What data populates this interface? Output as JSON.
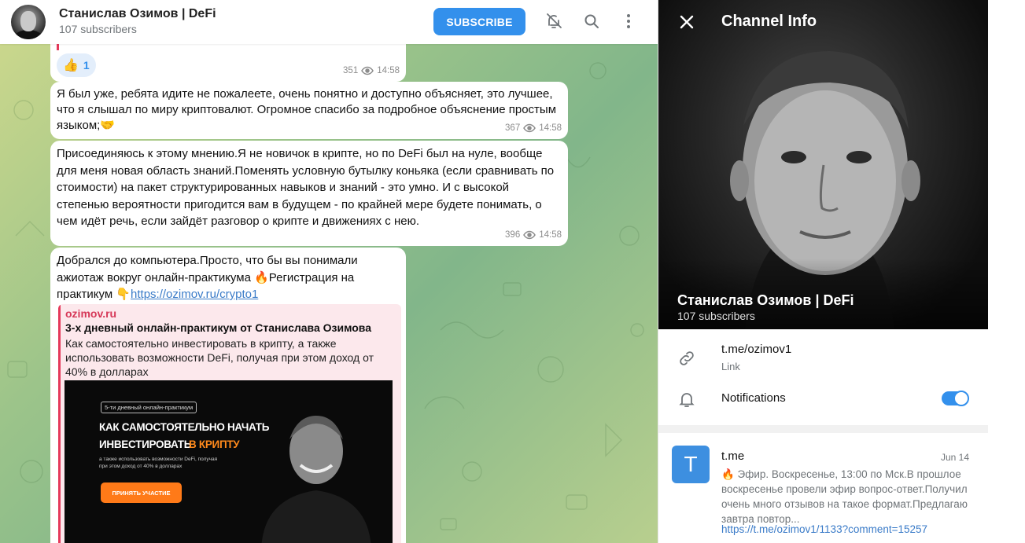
{
  "colors": {
    "accent": "#3390ec",
    "link": "#3a7bc8",
    "preview_accent": "#e5395a",
    "cta_orange": "#ff7a18"
  },
  "header": {
    "title": "Станислав Озимов | DeFi",
    "subscribers": "107 subscribers",
    "subscribe_label": "SUBSCRIBE",
    "icons": [
      "bell-off-icon",
      "search-icon",
      "more-vertical-icon"
    ]
  },
  "messages": [
    {
      "reaction_emoji": "👍",
      "reaction_count": "1",
      "views": "351",
      "time": "14:58"
    },
    {
      "text": "Я был уже, ребята идите не пожалеете, очень понятно и доступно объясняет, это лучшее, что я слышал по миру криптовалют. Огромное спасибо за подробное объяснение простым языком;🤝",
      "views": "367",
      "time": "14:58"
    },
    {
      "text": "Присоединяюсь к этому мнению.Я не новичок в крипте, но по DeFi был на нуле, вообще для меня новая область знаний.Поменять условную бутылку коньяка (если сравнивать по стоимости) на пакет структурированных навыков и знаний - это умно. И с высокой степенью вероятности пригодится вам в будущем - по крайней мере будете понимать, о чем идёт речь, если зайдёт разговор о крипте и движениях с нею.",
      "views": "396",
      "time": "14:58"
    },
    {
      "text": "Добрался до компьютера.Просто, что бы вы понимали ажиотаж вокруг онлайн-практикума 🔥Регистрация на практикум 👇",
      "link": "https://ozimov.ru/crypto1",
      "preview": {
        "site": "ozimov.ru",
        "title": "3-х дневный онлайн-практикум от Станислава Озимова",
        "description": "Как самостоятельно инвестировать в крипту, а также использовать возможности DeFi, получая при этом доход от 40% в долларах",
        "image": {
          "badge": "5-ти дневный онлайн-практикум",
          "line1": "КАК САМОСТОЯТЕЛЬНО НАЧАТЬ",
          "line2a": "ИНВЕСТИРОВАТЬ",
          "line2b": "В КРИПТУ",
          "small": "а также использовать возможности DeFi, получая при этом доход от 40% в долларах",
          "cta": "ПРИНЯТЬ УЧАСТИЕ"
        }
      }
    }
  ],
  "info": {
    "header_title": "Channel Info",
    "name": "Станислав Озимов | DeFi",
    "subscribers": "107 subscribers",
    "link_value": "t.me/ozimov1",
    "link_label": "Link",
    "notifications_label": "Notifications",
    "notifications_on": true,
    "result": {
      "avatar_letter": "T",
      "title": "t.me",
      "date": "Jun 14",
      "text": "🔥 Эфир. Воскресенье, 13:00 по Мск.В прошлое воскресенье провели эфир вопрос-ответ.Получил очень много отзывов на такое формат.Предлагаю завтра повтор...",
      "link": "https://t.me/ozimov1/1133?comment=15257"
    }
  }
}
